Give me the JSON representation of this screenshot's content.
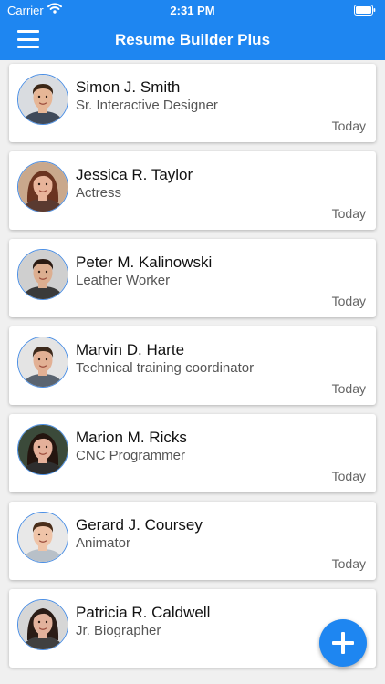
{
  "status_bar": {
    "carrier": "Carrier",
    "time": "2:31 PM",
    "wifi_icon": "wifi-icon",
    "battery_icon": "battery-icon"
  },
  "header": {
    "title": "Resume Builder Plus",
    "menu_icon": "hamburger-menu-icon",
    "background_color": "#1e86f1"
  },
  "resumes": [
    {
      "name": "Simon J. Smith",
      "title": "Sr. Interactive Designer",
      "date": "Today",
      "avatar": {
        "skin": "#e6b696",
        "hair": "#3a2616",
        "bg": "#d9dce0",
        "shirt": "#3f4a5a",
        "long_hair": false
      }
    },
    {
      "name": "Jessica R. Taylor",
      "title": "Actress",
      "date": "Today",
      "avatar": {
        "skin": "#e8b49a",
        "hair": "#6b3420",
        "bg": "#c9a88c",
        "shirt": "#5a3a30",
        "long_hair": true
      }
    },
    {
      "name": "Peter M. Kalinowski",
      "title": "Leather Worker",
      "date": "Today",
      "avatar": {
        "skin": "#dcae90",
        "hair": "#2a1a12",
        "bg": "#cfcfcf",
        "shirt": "#3a3a3a",
        "long_hair": false
      }
    },
    {
      "name": "Marvin D. Harte",
      "title": "Technical training coordinator",
      "date": "Today",
      "avatar": {
        "skin": "#e2b094",
        "hair": "#3d2a1c",
        "bg": "#e4e4e4",
        "shirt": "#5a6470",
        "long_hair": false
      }
    },
    {
      "name": "Marion M. Ricks",
      "title": "CNC Programmer",
      "date": "Today",
      "avatar": {
        "skin": "#e4b09a",
        "hair": "#24150f",
        "bg": "#3b4a3a",
        "shirt": "#2e2e2e",
        "long_hair": true
      }
    },
    {
      "name": "Gerard J. Coursey",
      "title": "Animator",
      "date": "Today",
      "avatar": {
        "skin": "#efc4a8",
        "hair": "#4a2e1a",
        "bg": "#e8e8e8",
        "shirt": "#b8c0c8",
        "long_hair": false
      }
    },
    {
      "name": "Patricia R. Caldwell",
      "title": "Jr. Biographer",
      "date": "",
      "avatar": {
        "skin": "#e2b29c",
        "hair": "#2a1c16",
        "bg": "#d6d6d6",
        "shirt": "#404040",
        "long_hair": true
      }
    }
  ],
  "fab": {
    "icon": "plus-icon",
    "label": "Add resume"
  }
}
